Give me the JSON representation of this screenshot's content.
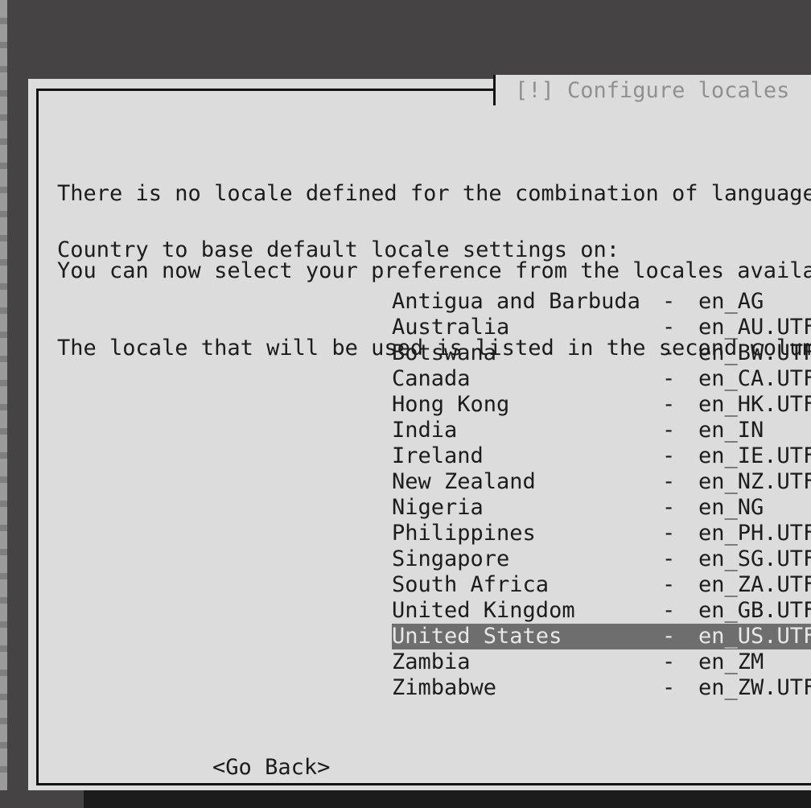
{
  "window": {
    "title": "[!] Configure locales"
  },
  "body": {
    "lines": [
      "There is no locale defined for the combination of language",
      "You can now select your preference from the locales availab",
      "The locale that will be used is listed in the second column"
    ]
  },
  "prompt": {
    "label": "Country to base default locale settings on:"
  },
  "list": {
    "separator": "-",
    "items": [
      {
        "country": "Antigua and Barbuda",
        "locale": "en_AG",
        "selected": false
      },
      {
        "country": "Australia",
        "locale": "en_AU.UTF",
        "selected": false
      },
      {
        "country": "Botswana",
        "locale": "en_BW.UTF",
        "selected": false
      },
      {
        "country": "Canada",
        "locale": "en_CA.UTF",
        "selected": false
      },
      {
        "country": "Hong Kong",
        "locale": "en_HK.UTF",
        "selected": false
      },
      {
        "country": "India",
        "locale": "en_IN",
        "selected": false
      },
      {
        "country": "Ireland",
        "locale": "en_IE.UTF",
        "selected": false
      },
      {
        "country": "New Zealand",
        "locale": "en_NZ.UTF",
        "selected": false
      },
      {
        "country": "Nigeria",
        "locale": "en_NG",
        "selected": false
      },
      {
        "country": "Philippines",
        "locale": "en_PH.UTF",
        "selected": false
      },
      {
        "country": "Singapore",
        "locale": "en_SG.UTF",
        "selected": false
      },
      {
        "country": "South Africa",
        "locale": "en_ZA.UTF",
        "selected": false
      },
      {
        "country": "United Kingdom",
        "locale": "en_GB.UTF",
        "selected": false
      },
      {
        "country": "United States",
        "locale": "en_US.UTF",
        "selected": true
      },
      {
        "country": "Zambia",
        "locale": "en_ZM",
        "selected": false
      },
      {
        "country": "Zimbabwe",
        "locale": "en_ZW.UTF",
        "selected": false
      }
    ]
  },
  "buttons": {
    "go_back": "<Go Back>"
  },
  "colors": {
    "desktop_background": "#454343",
    "dialog_background": "#dcdcdc",
    "border": "#121212",
    "text": "#1c1c1c",
    "title_text": "#909090",
    "selection_background": "#6e6e6e",
    "selection_text": "#e8e8e8",
    "bottom_strip": "#1c1c1c"
  }
}
